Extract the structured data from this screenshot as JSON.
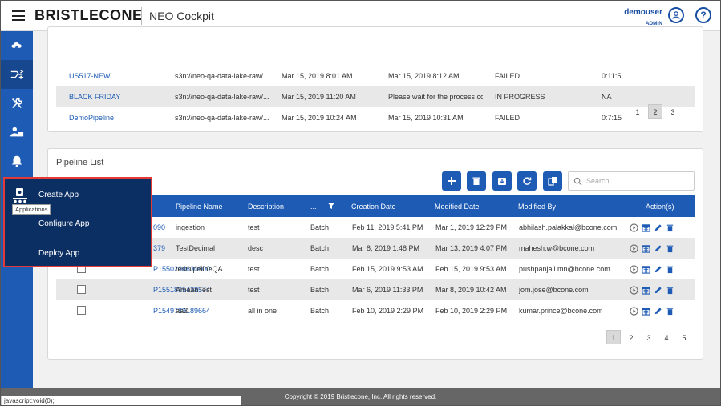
{
  "header": {
    "brand": "BRISTLECONE",
    "product": "NEO Cockpit",
    "user_name": "demouser",
    "user_role": "ADMIN",
    "user_icon": "user-circle-icon",
    "help_icon": "help-circle-icon",
    "help_glyph": "?"
  },
  "sidebar": {
    "items": [
      {
        "name": "cloud-upload-icon"
      },
      {
        "name": "pipeline-icon"
      },
      {
        "name": "tools-icon"
      },
      {
        "name": "user-admin-icon"
      },
      {
        "name": "bell-icon"
      },
      {
        "name": "applications-icon"
      }
    ]
  },
  "runs": {
    "rows": [
      {
        "name": "US517-NEW",
        "path": "s3n://neo-qa-data-lake-raw/...",
        "start": "Mar 15, 2019 8:01 AM",
        "end": "Mar 15, 2019 8:12 AM",
        "status": "FAILED",
        "duration": "0:11:5"
      },
      {
        "name": "BLACK FRIDAY",
        "path": "s3n://neo-qa-data-lake-raw/...",
        "start": "Mar 15, 2019 11:20 AM",
        "end": "Please wait for the process co",
        "status": "IN PROGRESS",
        "duration": "NA"
      },
      {
        "name": "DemoPipeline",
        "path": "s3n://neo-qa-data-lake-raw/...",
        "start": "Mar 15, 2019 10:24 AM",
        "end": "Mar 15, 2019 10:31 AM",
        "status": "FAILED",
        "duration": "0:7:15"
      }
    ],
    "pages": [
      "1",
      "2",
      "3"
    ],
    "active_page": "2"
  },
  "pipeline_list": {
    "title": "Pipeline List",
    "toolbar": [
      "add-icon",
      "delete-icon",
      "archive-icon",
      "refresh-icon",
      "export-icon"
    ],
    "search_placeholder": "Search",
    "columns": {
      "pipeline_name": "Pipeline Name",
      "description": "Description",
      "type": "...",
      "creation_date": "Creation Date",
      "modified_date": "Modified Date",
      "modified_by": "Modified By",
      "actions": "Action(s)"
    },
    "rows": [
      {
        "id": "090",
        "name": "ingestion",
        "description": "test",
        "type": "Batch",
        "created": "Feb 11, 2019 5:41 PM",
        "modified": "Mar 1, 2019 12:29 PM",
        "modified_by": "abhilash.palakkal@bcone.com"
      },
      {
        "id": "379",
        "name": "TestDecimal",
        "description": "desc",
        "type": "Batch",
        "created": "Mar 8, 2019 1:48 PM",
        "modified": "Mar 13, 2019 4:07 PM",
        "modified_by": "mahesh.w@bcone.com"
      },
      {
        "id": "P1550204630600",
        "name": "testpipelineQA",
        "description": "test",
        "type": "Batch",
        "created": "Feb 15, 2019 9:53 AM",
        "modified": "Feb 15, 2019 9:53 AM",
        "modified_by": "pushpanjali.mn@bcone.com"
      },
      {
        "id": "P1551895438574",
        "name": "AmaanTest",
        "description": "test",
        "type": "Batch",
        "created": "Mar 6, 2019 11:33 PM",
        "modified": "Mar 8, 2019 10:42 AM",
        "modified_by": "jom.jose@bcone.com"
      },
      {
        "id": "P1549789189664",
        "name": "aa3",
        "description": "all in one",
        "type": "Batch",
        "created": "Feb 10, 2019 2:29 PM",
        "modified": "Feb 10, 2019 2:29 PM",
        "modified_by": "kumar.prince@bcone.com"
      }
    ],
    "pages": [
      "1",
      "2",
      "3",
      "4",
      "5"
    ],
    "active_page": "1"
  },
  "app_menu": {
    "tooltip": "Applications",
    "items": [
      "Create App",
      "Configure App",
      "Deploy App"
    ]
  },
  "footer": {
    "copyright": "Copyright © 2019 Bristlecone, Inc. All rights reserved.",
    "status_url": "javascript:void(0);"
  },
  "colors": {
    "primary": "#1d5bb5",
    "menu_bg": "#0b2e63",
    "highlight_border": "#e53935"
  }
}
